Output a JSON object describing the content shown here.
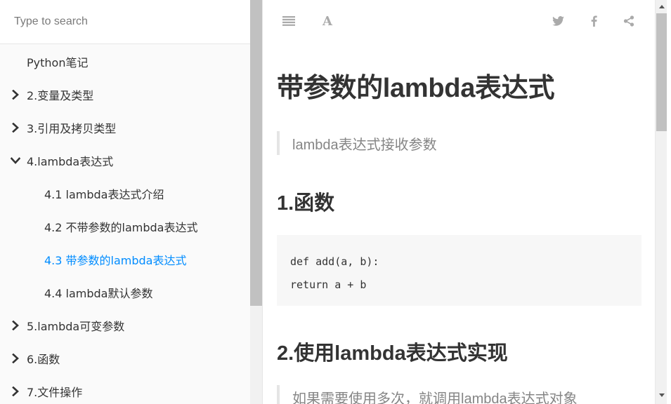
{
  "search": {
    "placeholder": "Type to search"
  },
  "sidebar": {
    "items": [
      {
        "label": "Python笔记",
        "level": "top",
        "expander": "none"
      },
      {
        "label": "2.变量及类型",
        "level": "top",
        "expander": "collapsed"
      },
      {
        "label": "3.引用及拷贝类型",
        "level": "top",
        "expander": "collapsed"
      },
      {
        "label": "4.lambda表达式",
        "level": "top",
        "expander": "expanded"
      },
      {
        "label": "4.1 lambda表达式介绍",
        "level": "sub",
        "expander": "none"
      },
      {
        "label": "4.2 不带参数的lambda表达式",
        "level": "sub",
        "expander": "none"
      },
      {
        "label": "4.3 带参数的lambda表达式",
        "level": "sub",
        "expander": "none",
        "active": true
      },
      {
        "label": "4.4 lambda默认参数",
        "level": "sub",
        "expander": "none"
      },
      {
        "label": "5.lambda可变参数",
        "level": "top",
        "expander": "collapsed"
      },
      {
        "label": "6.函数",
        "level": "top",
        "expander": "collapsed"
      },
      {
        "label": "7.文件操作",
        "level": "top",
        "expander": "collapsed"
      }
    ]
  },
  "toolbar": {
    "left_icons": [
      "list-icon",
      "font-settings-icon"
    ],
    "font_glyph": "A",
    "right_icons": [
      "twitter-icon",
      "facebook-icon",
      "share-icon"
    ]
  },
  "article": {
    "title": "带参数的lambda表达式",
    "intro_quote": "lambda表达式接收参数",
    "section1_heading": "1.函数",
    "code_lines": [
      "def add(a, b):",
      "return a + b"
    ],
    "section2_heading": "2.使用lambda表达式实现",
    "section2_quote": "如果需要使用多次，就调用lambda表达式对象"
  },
  "colors": {
    "accent": "#008cff",
    "text": "#333333",
    "muted": "#858585",
    "sidebar_bg": "#fafafa",
    "code_bg": "#f7f7f7"
  }
}
